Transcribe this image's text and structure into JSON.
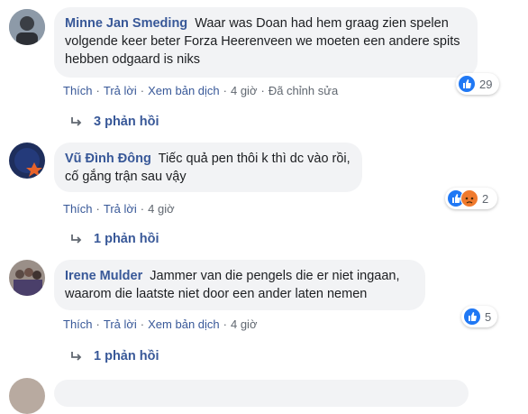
{
  "comments": [
    {
      "author": "Minne Jan Smeding",
      "text": "Waar was Doan had hem graag zien spelen volgende keer beter Forza Heerenveen we moeten een andere spits hebben odgaard is niks",
      "actions": {
        "like": "Thích",
        "reply": "Trả lời",
        "translate": "Xem bản dịch",
        "time": "4 giờ",
        "edited": "Đã chỉnh sửa"
      },
      "reaction_count": "29",
      "replies": "3 phản hồi"
    },
    {
      "author": "Vũ Đình Đông",
      "text": "Tiếc quả pen thôi k thì dc vào rồi, cố gắng trận sau vậy",
      "actions": {
        "like": "Thích",
        "reply": "Trả lời",
        "time": "4 giờ"
      },
      "reaction_count": "2",
      "replies": "1 phản hồi"
    },
    {
      "author": "Irene Mulder",
      "text": "Jammer van die pengels die er niet ingaan, waarom die laatste niet door een ander laten nemen",
      "actions": {
        "like": "Thích",
        "reply": "Trả lời",
        "translate": "Xem bản dịch",
        "time": "4 giờ"
      },
      "reaction_count": "5",
      "replies": "1 phản hồi"
    }
  ],
  "colors": {
    "link": "#385898",
    "bubble": "#f2f3f5",
    "like": "#2078f4",
    "sad": "#f0ba15"
  }
}
